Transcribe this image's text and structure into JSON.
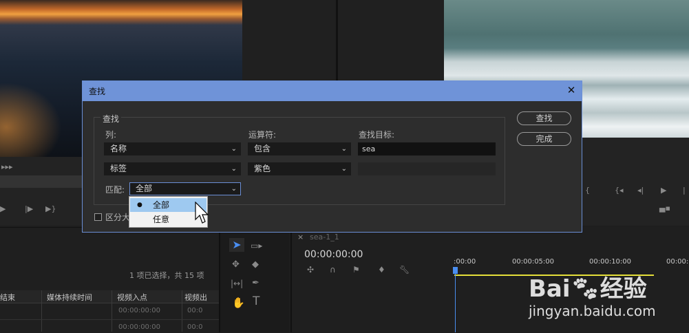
{
  "dialog": {
    "title": "查找",
    "group_title": "查找",
    "col_label": "列:",
    "op_label": "运算符:",
    "target_label": "查找目标:",
    "row1": {
      "column": "名称",
      "operator": "包含",
      "target": "sea"
    },
    "row2": {
      "column": "标签",
      "operator": "紫色",
      "target": ""
    },
    "match_label": "匹配:",
    "match_value": "全部",
    "match_options": [
      "全部",
      "任意"
    ],
    "case_checkbox_label": "区分大",
    "find_button": "查找",
    "done_button": "完成"
  },
  "project_panel": {
    "selection_status": "1 项已选择，共 15 项",
    "columns": [
      "结束",
      "媒体持续时间",
      "视频入点",
      "视频出"
    ],
    "rows": [
      [
        "",
        "",
        "00:00:00:00",
        "00:0"
      ],
      [
        "",
        "",
        "00:00:00:00",
        "00:0"
      ]
    ]
  },
  "timeline": {
    "tab_label": "sea-1_1",
    "timecode": "00:00:00:00",
    "ruler": [
      ":00:00",
      "00:00:05:00",
      "00:00:10:00",
      "00:00:1"
    ]
  },
  "watermark": {
    "brand": "Bai",
    "brand2": "经验",
    "url": "jingyan.baidu.com"
  },
  "colors": {
    "titlebar": "#6f93d8",
    "dropdown_selected": "#9ec9f0",
    "playhead": "#4a8ef0",
    "workarea": "#e6e03a"
  }
}
